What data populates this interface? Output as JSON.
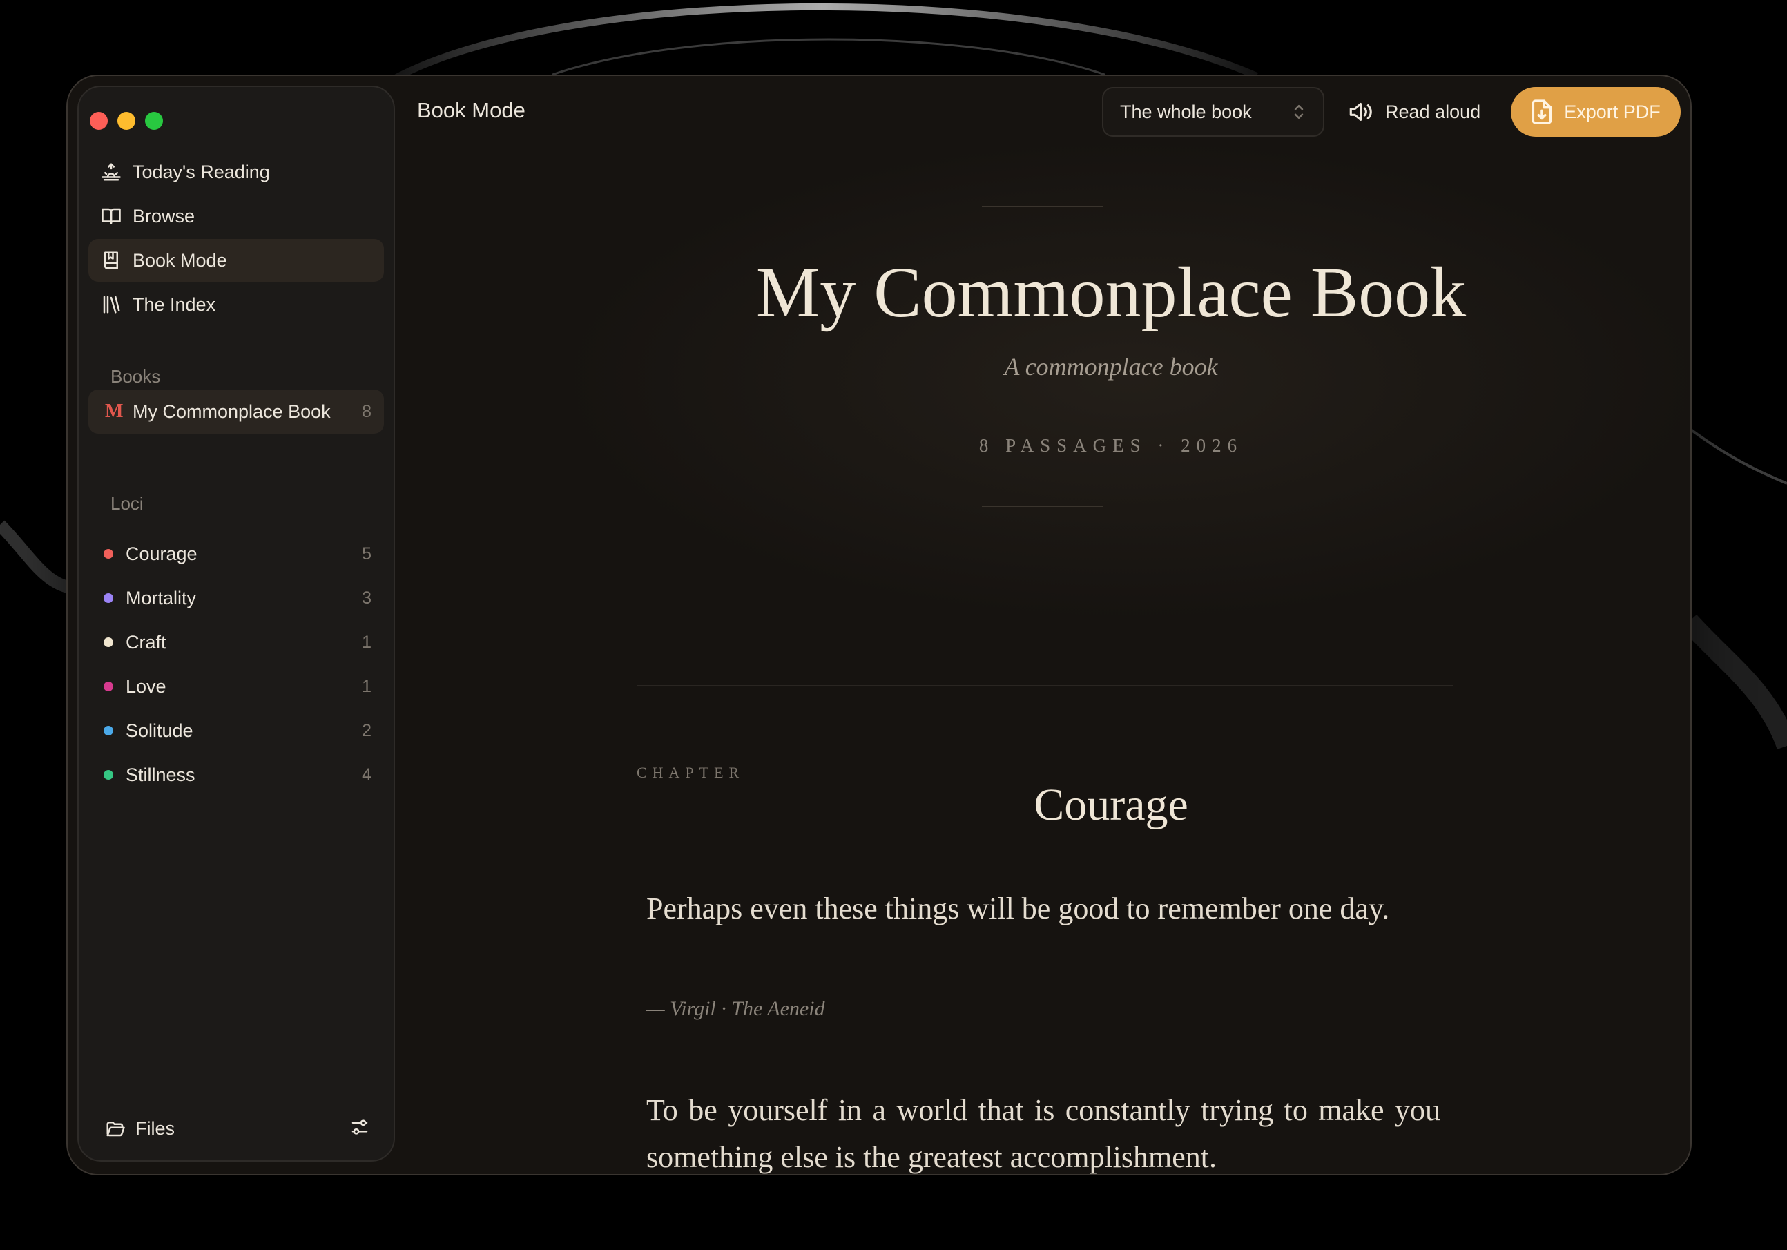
{
  "window": {
    "title": "Book Mode"
  },
  "sidebar": {
    "nav": [
      {
        "label": "Today's Reading",
        "icon": "sunrise-icon"
      },
      {
        "label": "Browse",
        "icon": "open-book-icon"
      },
      {
        "label": "Book Mode",
        "icon": "bookmark-book-icon",
        "active": true
      },
      {
        "label": "The Index",
        "icon": "library-icon"
      }
    ],
    "books_label": "Books",
    "books": [
      {
        "initial": "M",
        "title": "My Commonplace Book",
        "count": "8"
      }
    ],
    "loci_label": "Loci",
    "loci": [
      {
        "label": "Courage",
        "count": "5",
        "color": "#f0605a"
      },
      {
        "label": "Mortality",
        "count": "3",
        "color": "#9b83f5"
      },
      {
        "label": "Craft",
        "count": "1",
        "color": "#f1e6cf"
      },
      {
        "label": "Love",
        "count": "1",
        "color": "#d63a8e"
      },
      {
        "label": "Solitude",
        "count": "2",
        "color": "#4ba9e8"
      },
      {
        "label": "Stillness",
        "count": "4",
        "color": "#35c783"
      }
    ],
    "footer": {
      "files_label": "Files"
    }
  },
  "toolbar": {
    "scope": "The whole book",
    "read_aloud": "Read aloud",
    "export": "Export PDF",
    "accent": "#e0a046"
  },
  "book": {
    "title": "My Commonplace Book",
    "subtitle": "A commonplace book",
    "meta": "8 PASSAGES · 2026",
    "chapter_label": "CHAPTER",
    "chapter_title": "Courage",
    "passages": [
      {
        "text": "Perhaps even these things will be good to remember one day.",
        "attribution": "— Virgil · The Aeneid"
      },
      {
        "text": "To be yourself in a world that is constantly trying to make you something else is the greatest accomplishment."
      }
    ]
  }
}
